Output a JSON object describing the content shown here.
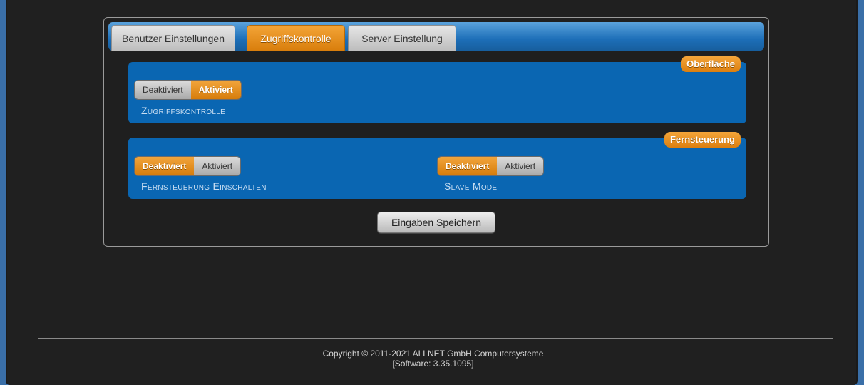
{
  "tabs": [
    {
      "label": "Benutzer Einstellungen",
      "active": false
    },
    {
      "label": "Zugriffskontrolle",
      "active": true
    },
    {
      "label": "Server Einstellung",
      "active": false
    }
  ],
  "sections": {
    "surface": {
      "badge": "Oberfläche",
      "access_control": {
        "label": "Zugriffskontrolle",
        "off_label": "Deaktiviert",
        "on_label": "Aktiviert",
        "selected": "Aktiviert"
      }
    },
    "remote": {
      "badge": "Fernsteuerung",
      "remote_enable": {
        "label": "Fernsteuerung Einschalten",
        "off_label": "Deaktiviert",
        "on_label": "Aktiviert",
        "selected": "Deaktiviert"
      },
      "slave_mode": {
        "label": "Slave Mode",
        "off_label": "Deaktiviert",
        "on_label": "Aktiviert",
        "selected": "Deaktiviert"
      }
    }
  },
  "save_label": "Eingaben Speichern",
  "footer": {
    "copyright": "Copyright © 2011-2021 ALLNET GmbH Computersysteme",
    "software": "[Software: 3.35.1095]"
  },
  "colors": {
    "accent": "#e08a1a",
    "section_blue": "#0a66b2",
    "background": "#202020",
    "outer_blue": "#3a6fa8"
  }
}
